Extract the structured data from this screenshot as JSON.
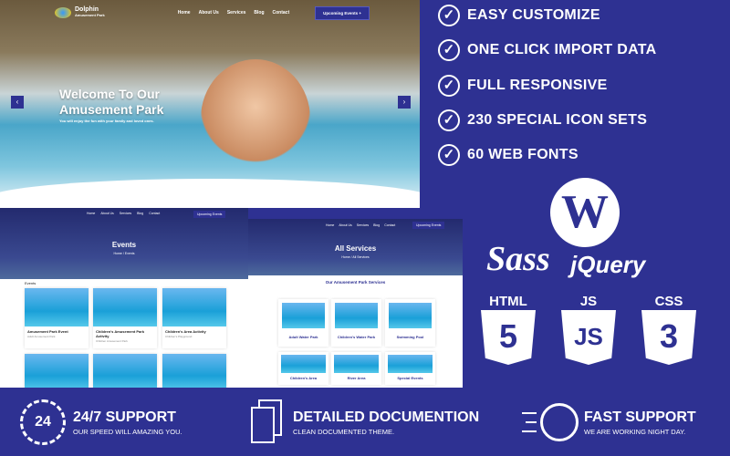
{
  "hero": {
    "brand": "Dolphin",
    "brand_sub": "Amusement Park",
    "menu": [
      "Home",
      "About Us",
      "Services",
      "Blog",
      "Contact"
    ],
    "cta": "Upcoming Events +",
    "title_line1": "Welcome To Our",
    "title_line2": "Amusement Park",
    "subtitle": "You will enjoy the fun with your family and loved ones.",
    "prev": "‹",
    "next": "›"
  },
  "events_page": {
    "menu": [
      "Home",
      "About Us",
      "Services",
      "Blog",
      "Contact"
    ],
    "cta": "Upcoming Events",
    "title": "Events",
    "breadcrumb": "Home / Events",
    "section": "Events",
    "cards": [
      {
        "title": "Amusement Park Event",
        "tag": "Adult Amusement Park"
      },
      {
        "title": "Children's Amusement Park Activity",
        "tag": "Children Amusement Park"
      },
      {
        "title": "Children's Area Activity",
        "tag": "Children's Playground"
      }
    ]
  },
  "services_page": {
    "menu": [
      "Home",
      "About Us",
      "Services",
      "Blog",
      "Contact"
    ],
    "cta": "Upcoming Events",
    "title": "All Services",
    "breadcrumb": "Home / All Services",
    "section": "Our Amusement Park Services",
    "cards": [
      "Adult Water Park",
      "Children's Water Park",
      "Swimming Pool",
      "Children's Area",
      "River Area",
      "Special Events"
    ]
  },
  "features": [
    "EASY CUSTOMIZE",
    "ONE CLICK IMPORT DATA",
    "FULL RESPONSIVE",
    "230 SPECIAL ICON SETS",
    "60 WEB FONTS"
  ],
  "tech": {
    "sass": "Sass",
    "jquery": "jQuery",
    "shields": [
      {
        "label": "HTML",
        "num": "5"
      },
      {
        "label": "JS",
        "num": "JS"
      },
      {
        "label": "CSS",
        "num": "3"
      }
    ]
  },
  "bottom": [
    {
      "title": "24/7 SUPPORT",
      "sub": "OUR SPEED WILL AMAZING YOU.",
      "icon": "24"
    },
    {
      "title": "DETAILED DOCUMENTION",
      "sub": "CLEAN DOCUMENTED THEME."
    },
    {
      "title": "FAST SUPPORT",
      "sub": "WE ARE WORKING NIGHT DAY."
    }
  ],
  "colors": {
    "brand": "#2e3192"
  }
}
